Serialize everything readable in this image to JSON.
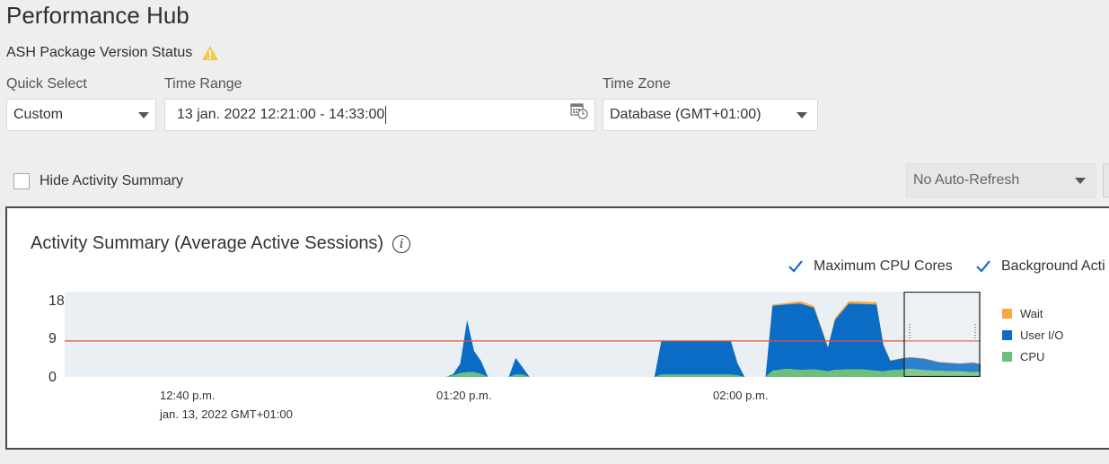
{
  "page": {
    "title": "Performance Hub",
    "ash_status": "ASH Package Version Status"
  },
  "filters": {
    "quick_select": {
      "label": "Quick Select",
      "value": "Custom"
    },
    "time_range": {
      "label": "Time Range",
      "value": "13 jan. 2022 12:21:00 - 14:33:00"
    },
    "time_zone": {
      "label": "Time Zone",
      "value": "Database (GMT+01:00)"
    }
  },
  "hide_activity": {
    "label": "Hide Activity Summary",
    "checked": false
  },
  "auto_refresh": {
    "value": "No Auto-Refresh"
  },
  "summary": {
    "title": "Activity Summary (Average Active Sessions)",
    "options": [
      {
        "label": "Maximum CPU Cores",
        "checked": true
      },
      {
        "label": "Background Acti",
        "checked": true
      }
    ]
  },
  "colors": {
    "wait": "#f5a742",
    "user_io": "#0a6cc5",
    "cpu": "#6cc07c",
    "max_cpu_line": "#e8513a",
    "warning": "#f2c94c"
  },
  "icons": [
    "warning-icon",
    "calendar-clock-icon",
    "info-icon",
    "check-icon",
    "dropdown-caret-icon"
  ],
  "chart_data": {
    "type": "area",
    "stacked": true,
    "x_unit": "minutes since 12:21",
    "y_ticks": [
      "18",
      "9",
      "0"
    ],
    "y_tick_values": [
      18,
      9,
      0
    ],
    "ylim": [
      0,
      18
    ],
    "x_ticks": [
      {
        "label": "12:40 p.m.",
        "sub": "jan. 13, 2022 GMT+01:00",
        "x": 19
      },
      {
        "label": "01:20 p.m.",
        "x": 59
      },
      {
        "label": "02:00 p.m.",
        "x": 99
      }
    ],
    "max_cpu_cores": 7.6,
    "legend": [
      "Wait",
      "User I/O",
      "CPU"
    ],
    "series": [
      {
        "name": "CPU",
        "values": [
          [
            0,
            0
          ],
          [
            55,
            0
          ],
          [
            56,
            0.3
          ],
          [
            57,
            0.8
          ],
          [
            58,
            1.0
          ],
          [
            59,
            1.0
          ],
          [
            60,
            0.6
          ],
          [
            61,
            0
          ],
          [
            64,
            0
          ],
          [
            65,
            0.5
          ],
          [
            66,
            0.5
          ],
          [
            67,
            0
          ],
          [
            85,
            0
          ],
          [
            86,
            0.5
          ],
          [
            91,
            0.5
          ],
          [
            96,
            0.5
          ],
          [
            97,
            0.3
          ],
          [
            98,
            0
          ],
          [
            101,
            0
          ],
          [
            102,
            1.3
          ],
          [
            104,
            1.7
          ],
          [
            106,
            1.5
          ],
          [
            108,
            1.6
          ],
          [
            110,
            1.2
          ],
          [
            111,
            1.5
          ],
          [
            113,
            1.6
          ],
          [
            115,
            1.6
          ],
          [
            117,
            1.3
          ],
          [
            118,
            1.2
          ],
          [
            119,
            1.4
          ],
          [
            121,
            1.6
          ],
          [
            122,
            1.7
          ],
          [
            124,
            1.4
          ],
          [
            126,
            1.3
          ],
          [
            128,
            1.2
          ],
          [
            129,
            1.2
          ],
          [
            131,
            1.0
          ],
          [
            132,
            1.2
          ],
          [
            132.01,
            0
          ]
        ]
      },
      {
        "name": "User I/O",
        "values": [
          [
            0,
            0
          ],
          [
            55,
            0
          ],
          [
            56,
            0.3
          ],
          [
            57,
            2.0
          ],
          [
            58,
            11.0
          ],
          [
            59,
            4.5
          ],
          [
            60,
            2.8
          ],
          [
            61,
            0
          ],
          [
            64,
            0
          ],
          [
            65,
            3.5
          ],
          [
            66,
            1.5
          ],
          [
            67,
            0
          ],
          [
            85,
            0
          ],
          [
            86,
            7.1
          ],
          [
            91,
            7.0
          ],
          [
            96,
            7.1
          ],
          [
            97,
            2.5
          ],
          [
            98,
            0
          ],
          [
            101,
            0
          ],
          [
            102,
            13.7
          ],
          [
            104,
            13.6
          ],
          [
            106,
            14.0
          ],
          [
            108,
            13.0
          ],
          [
            110,
            5.0
          ],
          [
            111,
            10.5
          ],
          [
            113,
            13.9
          ],
          [
            115,
            13.8
          ],
          [
            117,
            14.0
          ],
          [
            118,
            5.5
          ],
          [
            119,
            2.0
          ],
          [
            121,
            2.4
          ],
          [
            122,
            2.4
          ],
          [
            124,
            2.4
          ],
          [
            126,
            1.8
          ],
          [
            128,
            1.7
          ],
          [
            129,
            1.6
          ],
          [
            131,
            2.0
          ],
          [
            132,
            1.5
          ],
          [
            132.01,
            0
          ]
        ]
      },
      {
        "name": "Wait",
        "values": [
          [
            0,
            0
          ],
          [
            55,
            0
          ],
          [
            56,
            0
          ],
          [
            57,
            0
          ],
          [
            58,
            0
          ],
          [
            59,
            0
          ],
          [
            60,
            0
          ],
          [
            61,
            0
          ],
          [
            64,
            0
          ],
          [
            65,
            0
          ],
          [
            66,
            0
          ],
          [
            67,
            0
          ],
          [
            85,
            0
          ],
          [
            86,
            0.1
          ],
          [
            91,
            0.1
          ],
          [
            96,
            0.1
          ],
          [
            97,
            0
          ],
          [
            98,
            0
          ],
          [
            101,
            0
          ],
          [
            102,
            0.3
          ],
          [
            104,
            0.3
          ],
          [
            106,
            0.5
          ],
          [
            108,
            0.4
          ],
          [
            110,
            0.2
          ],
          [
            111,
            0.4
          ],
          [
            113,
            0.5
          ],
          [
            115,
            0.5
          ],
          [
            117,
            0.5
          ],
          [
            118,
            0.2
          ],
          [
            119,
            0.1
          ],
          [
            121,
            0.1
          ],
          [
            122,
            0.1
          ],
          [
            124,
            0.1
          ],
          [
            126,
            0.1
          ],
          [
            128,
            0.1
          ],
          [
            129,
            0.1
          ],
          [
            131,
            0.1
          ],
          [
            132,
            0.1
          ],
          [
            132.01,
            0
          ]
        ]
      }
    ],
    "selection": {
      "from": 121,
      "to": 132
    }
  }
}
